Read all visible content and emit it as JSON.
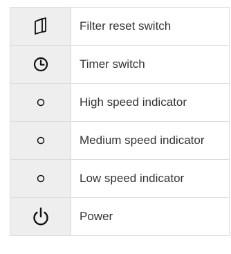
{
  "legend": {
    "rows": [
      {
        "icon": "filter-icon",
        "label": "Filter reset switch"
      },
      {
        "icon": "clock-icon",
        "label": "Timer switch"
      },
      {
        "icon": "circle-indicator-icon",
        "label": "High speed indicator"
      },
      {
        "icon": "circle-indicator-icon",
        "label": "Medium speed indicator"
      },
      {
        "icon": "circle-indicator-icon",
        "label": "Low speed indicator"
      },
      {
        "icon": "power-icon",
        "label": "Power"
      }
    ]
  },
  "colors": {
    "icon_cell_background": "#eeeeee",
    "border": "#dcdcdc",
    "text": "#333333",
    "icon": "#111111"
  }
}
